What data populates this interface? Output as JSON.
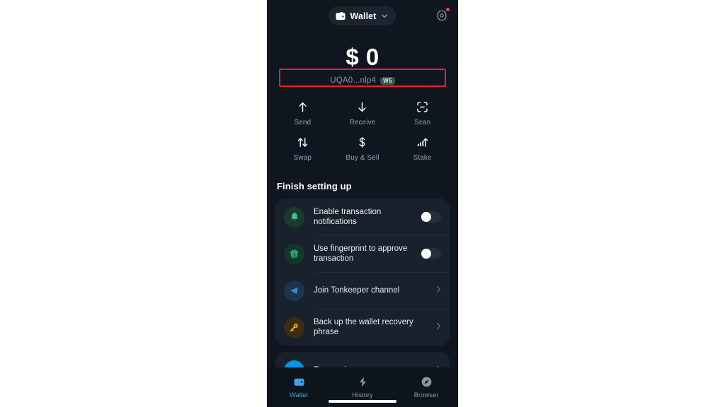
{
  "header": {
    "wallet_chip_label": "Wallet",
    "wallet_icon": "wallet-icon",
    "chevron_icon": "chevron-down-icon",
    "settings_icon": "gear-icon",
    "settings_badge_color": "#ef4060"
  },
  "balance": {
    "amount": "$ 0",
    "address": "UQA0...nlp4",
    "version_badge": "W5",
    "version_badge_color": "#2e5b46"
  },
  "annotation": {
    "color": "#e8202a",
    "target": "wallet-address-row"
  },
  "actions": [
    {
      "label": "Send",
      "icon": "arrow-up-icon"
    },
    {
      "label": "Receive",
      "icon": "arrow-down-icon"
    },
    {
      "label": "Scan",
      "icon": "scan-icon"
    },
    {
      "label": "Swap",
      "icon": "swap-arrows-icon"
    },
    {
      "label": "Buy & Sell",
      "icon": "dollar-icon"
    },
    {
      "label": "Stake",
      "icon": "stake-chart-icon"
    }
  ],
  "setup": {
    "section_title": "Finish setting up",
    "items": [
      {
        "text": "Enable transaction notifications",
        "icon": "bell-icon",
        "icon_color": "#37c98b",
        "control": "toggle",
        "toggle_on": false
      },
      {
        "text": "Use fingerprint to approve transaction",
        "icon": "fingerprint-icon",
        "icon_color": "#37c98b",
        "control": "toggle",
        "toggle_on": false
      },
      {
        "text": "Join Tonkeeper channel",
        "icon": "telegram-icon",
        "icon_color": "#3c8fd8",
        "control": "chevron"
      },
      {
        "text": "Back up the wallet recovery phrase",
        "icon": "key-icon",
        "icon_color": "#f5a623",
        "control": "chevron"
      }
    ],
    "partial_item": {
      "text": "Top up via",
      "icon": "ton-coin-icon",
      "control": "chevron"
    }
  },
  "tabbar": {
    "tabs": [
      {
        "label": "Wallet",
        "icon": "wallet-tab-icon",
        "active": true
      },
      {
        "label": "History",
        "icon": "history-bolt-icon",
        "active": false
      },
      {
        "label": "Browser",
        "icon": "browser-compass-icon",
        "active": false
      }
    ],
    "active_color": "#3c9fe8"
  }
}
